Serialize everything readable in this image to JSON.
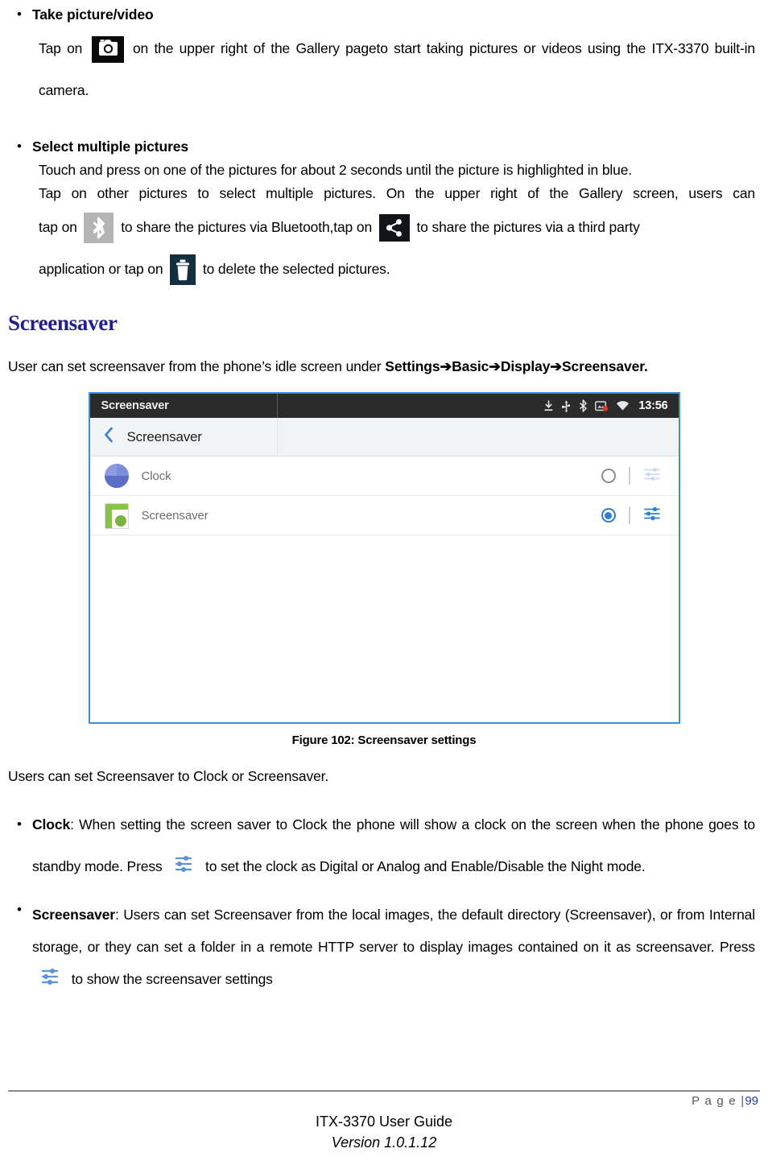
{
  "section_take_picture": {
    "bullet": "•",
    "heading": "Take picture/video",
    "text_before_icon": "Tap on",
    "icon_name": "camera-icon",
    "text_after_icon": "on the upper right of the Gallery pageto start taking pictures or videos using the ITX-3370 built-in camera."
  },
  "section_select_pictures": {
    "bullet": "•",
    "heading": "Select multiple pictures",
    "line1": "Touch and press on one of the pictures for about 2 seconds until the picture is highlighted in blue.",
    "line2": "Tap on other pictures to select multiple pictures. On the upper right of the Gallery screen, users can",
    "frag_tap_on": "tap on",
    "bluetooth_icon_name": "bluetooth-icon",
    "frag_share_bt": "to share the pictures via Bluetooth,tap on",
    "share_icon_name": "share-icon",
    "frag_share_third": "to share the pictures via a third party",
    "frag_app_or_tap": "application or tap on",
    "trash_icon_name": "delete-trash-icon",
    "frag_delete": "to delete the selected pictures."
  },
  "screensaver_heading": "Screensaver",
  "screensaver_intro": {
    "prefix": "User can set screensaver from the phone’s idle screen under ",
    "path": "Settings➔Basic➔Display➔Screensaver."
  },
  "device_screenshot": {
    "status_bar": {
      "title": "Screensaver",
      "icons": [
        "download-icon",
        "usb-icon",
        "bluetooth-icon",
        "screenshot-sd-icon",
        "wifi-icon"
      ],
      "time": "13:56"
    },
    "action_bar": {
      "back_icon": "chevron-left-icon",
      "title": "Screensaver"
    },
    "rows": [
      {
        "icon": "clock-app-icon",
        "label": "Clock",
        "selected": false,
        "settings_icon": "tune-sliders-icon"
      },
      {
        "icon": "screensaver-app-icon",
        "label": "Screensaver",
        "selected": true,
        "settings_icon": "tune-sliders-icon"
      }
    ]
  },
  "figure_caption": "Figure 102: Screensaver settings",
  "after_figure_text": "Users can set Screensaver to Clock or Screensaver.",
  "section_clock": {
    "bullet": "•",
    "heading": "Clock",
    "text_before_icon": ": When setting the screen saver to Clock the phone will show a clock on the screen when the phone goes to standby mode. Press",
    "icon_name": "tune-sliders-icon",
    "text_after_icon": "to set the clock as Digital or Analog and Enable/Disable the Night mode."
  },
  "section_screensaver": {
    "bullet": "•",
    "heading": "Screensaver",
    "text_before_icon": ": Users can set Screensaver from the local images, the default directory (Screensaver), or from Internal storage, or they can set a folder in a remote HTTP server to display images contained on it as screensaver. Press",
    "icon_name": "tune-sliders-icon",
    "text_after_icon": "to show the screensaver settings"
  },
  "footer": {
    "page_label": "P a g e |",
    "page_number": "99",
    "doc_title": "ITX-3370 User Guide",
    "version": "Version 1.0.1.12"
  },
  "colors": {
    "heading_blue": "#1f1f8f",
    "accent_blue": "#2f7fd0",
    "statusbar_dark": "#2b2b2b",
    "screenshot_border": "#3f8fd8",
    "page_number_blue": "#1f3fa0"
  }
}
